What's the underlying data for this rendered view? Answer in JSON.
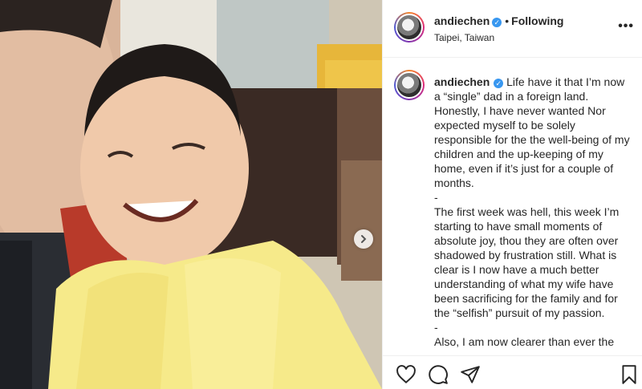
{
  "post": {
    "username": "andiechen",
    "follow_status": "Following",
    "location": "Taipei, Taiwan",
    "more_label": "•••",
    "caption": "Life have it that I’m now a “single” dad in a foreign land. Honestly, I have never wanted Nor expected myself to be solely responsible for the the well-being of my children and the up-keeping of my home, even if it’s just for a couple of months.\n-\nThe first week was hell, this week I’m starting to have small moments of absolute joy, thou they are often over shadowed by frustration still. What is clear is I now have a much better understanding of what my wife have been sacrificing for the family and for the “selfish” pursuit of my passion.\n-\nAlso, I am now clearer than ever the"
  },
  "icons": {
    "verified": "verified-badge-icon",
    "next": "chevron-right-icon",
    "like": "heart-icon",
    "comment": "comment-icon",
    "share": "paper-plane-icon",
    "save": "bookmark-icon"
  },
  "colors": {
    "verified_blue": "#3897f0",
    "border": "#efefef",
    "text": "#262626"
  }
}
